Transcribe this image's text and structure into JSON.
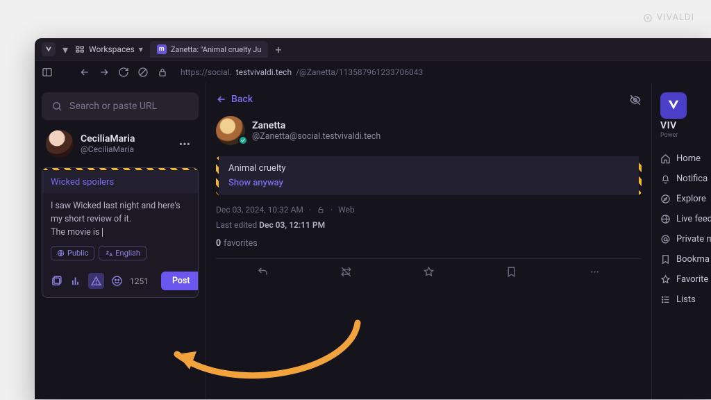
{
  "watermark": "VIVALDI",
  "tabbar": {
    "workspaces": "Workspaces",
    "tab_title": "Zanetta: \"Animal cruelty Ju"
  },
  "addressbar": {
    "url_dim1": "https://social.",
    "url_bold": "testvivaldi.tech",
    "url_dim2": "/@Zanetta/113587961233706043"
  },
  "search": {
    "placeholder": "Search or paste URL"
  },
  "profile": {
    "name": "CeciliaMaria",
    "handle": "@CeciliaMaria"
  },
  "compose": {
    "cw": "Wicked spoilers",
    "body": "I saw Wicked last night and here's my short review of it.\nThe movie is ",
    "visibility": "Public",
    "language": "English",
    "char_count": "1251",
    "post": "Post"
  },
  "main": {
    "back": "Back",
    "poster_name": "Zanetta",
    "poster_handle": "@Zanetta@social.testvivaldi.tech",
    "cw_text": "Animal cruelty",
    "show_anyway": "Show anyway",
    "timestamp": "Dec 03, 2024, 10:32 AM",
    "client": "Web",
    "edited_prefix": "Last edited ",
    "edited_time": "Dec 03, 12:11 PM",
    "fav_count": "0",
    "fav_label": "favorites"
  },
  "sidebar": {
    "brand": "VIV",
    "sub": "Power",
    "items": [
      "Home",
      "Notifica",
      "Explore",
      "Live feed",
      "Private m",
      "Bookma",
      "Favorite",
      "Lists"
    ]
  }
}
